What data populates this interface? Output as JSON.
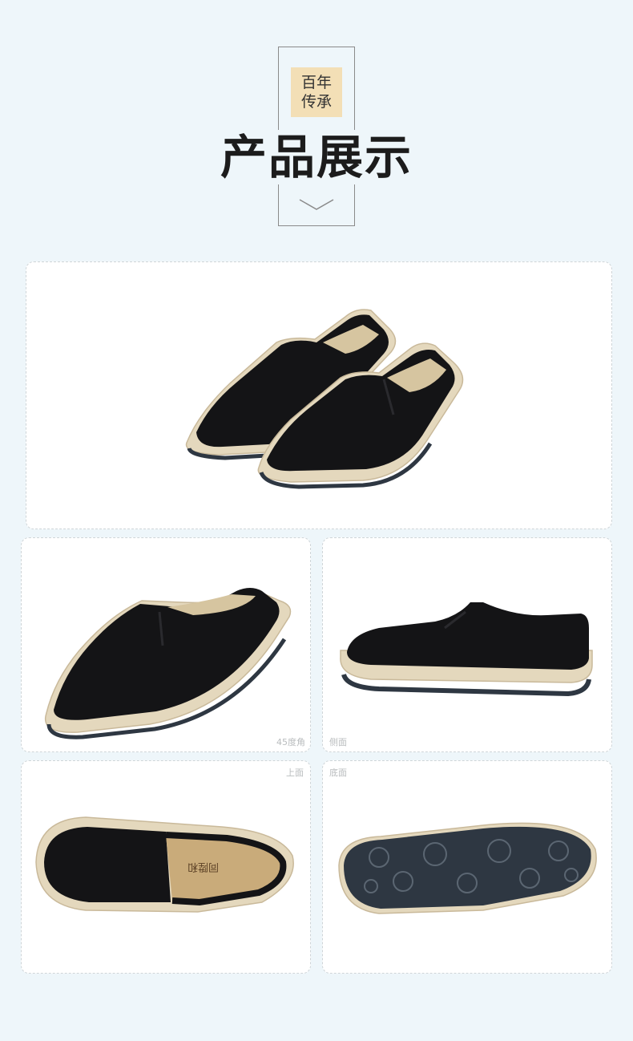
{
  "header": {
    "badge_line1": "百年",
    "badge_line2": "传承",
    "title": "产品展示"
  },
  "captions": {
    "angle45": "45度角",
    "side": "侧面",
    "top": "上面",
    "bottom": "底面"
  },
  "colors": {
    "background": "#eef6fa",
    "badge": "#f3dfb6",
    "shoe_upper": "#141416",
    "jute_trim": "#e4d8bd",
    "insole": "#c9ab7a",
    "outsole": "#2e3742"
  }
}
